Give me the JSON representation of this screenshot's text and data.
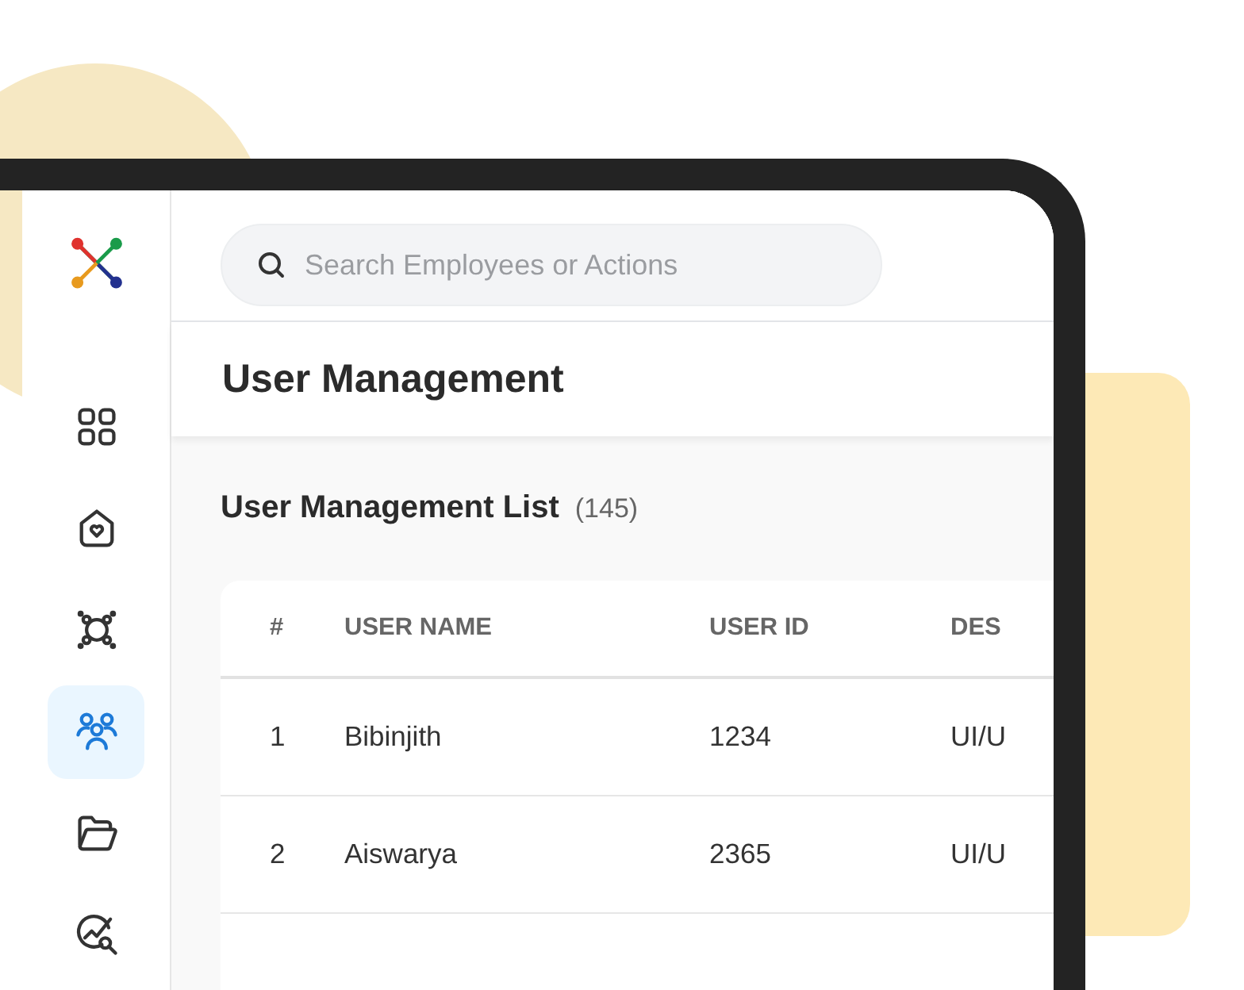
{
  "sidebar": {
    "items": [
      {
        "selected": false
      },
      {
        "selected": false
      },
      {
        "selected": false
      },
      {
        "selected": true
      },
      {
        "selected": false
      },
      {
        "selected": false
      }
    ]
  },
  "search": {
    "placeholder": "Search Employees or Actions"
  },
  "page_title": "User Management",
  "list": {
    "title": "User Management List",
    "count": "(145)"
  },
  "table": {
    "columns": [
      "#",
      "USER NAME",
      "USER ID",
      "DES"
    ],
    "rows": [
      [
        "1",
        "Bibinjith",
        "1234",
        "UI/U"
      ],
      [
        "2",
        "Aiswarya",
        "2365",
        "UI/U"
      ]
    ]
  }
}
